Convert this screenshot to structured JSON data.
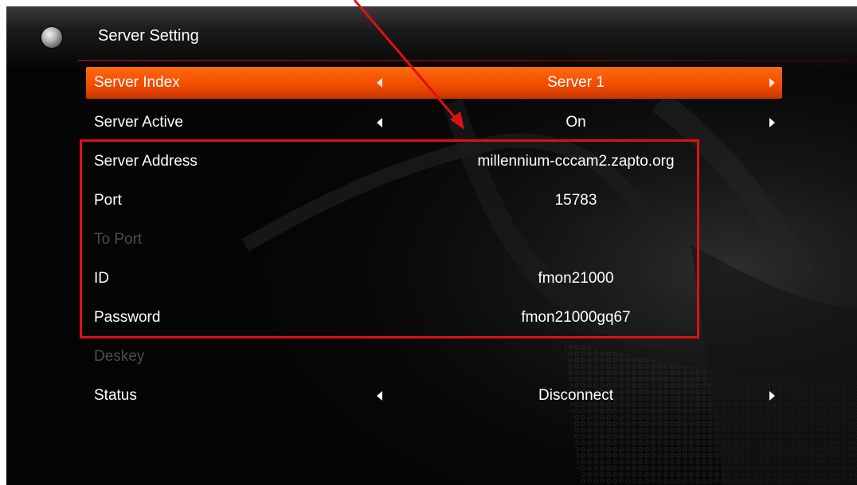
{
  "header": {
    "title": "Server Setting",
    "logo_icon": "globe-icon"
  },
  "rows": [
    {
      "label": "Server Index",
      "value": "Server 1",
      "state": "selected",
      "has_arrows": true
    },
    {
      "label": "Server Active",
      "value": "On",
      "state": "normal",
      "has_arrows": true
    },
    {
      "label": "Server Address",
      "value": "millennium-cccam2.zapto.org",
      "state": "normal",
      "has_arrows": false
    },
    {
      "label": "Port",
      "value": "15783",
      "state": "normal",
      "has_arrows": false
    },
    {
      "label": "To Port",
      "value": "",
      "state": "disabled",
      "has_arrows": false
    },
    {
      "label": "ID",
      "value": "fmon21000",
      "state": "normal",
      "has_arrows": false
    },
    {
      "label": "Password",
      "value": "fmon21000gq67",
      "state": "normal",
      "has_arrows": false
    },
    {
      "label": "Deskey",
      "value": "",
      "state": "disabled",
      "has_arrows": false
    },
    {
      "label": "Status",
      "value": "Disconnect",
      "state": "normal",
      "has_arrows": true
    }
  ],
  "colors": {
    "selected_row": "#f24d00",
    "annotation": "#e01010",
    "disabled_text": "#4d4d4d",
    "text": "#ffffff"
  }
}
